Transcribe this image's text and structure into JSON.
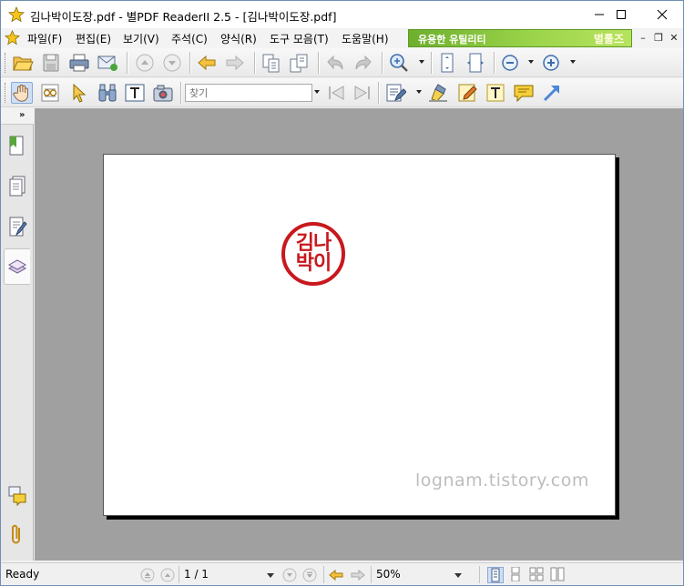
{
  "window": {
    "title": "김나박이도장.pdf - 별PDF ReaderII 2.5 - [김나박이도장.pdf]",
    "controls": {
      "minimize": "–",
      "maximize": "☐",
      "close": "✕"
    }
  },
  "menubar": {
    "items": [
      {
        "label": "파일(F)"
      },
      {
        "label": "편집(E)"
      },
      {
        "label": "보기(V)"
      },
      {
        "label": "주석(C)"
      },
      {
        "label": "양식(R)"
      },
      {
        "label": "도구 모음(T)"
      },
      {
        "label": "도움말(H)"
      }
    ],
    "utility_banner": "유용한 유틸리티",
    "utility_brand": "별툴즈",
    "mdi": {
      "minimize": "–",
      "restore": "❐",
      "close": "✕"
    }
  },
  "toolbar2": {
    "find_placeholder": "찾기"
  },
  "document": {
    "seal_line1": "김나",
    "seal_line2": "박이",
    "watermark": "lognam.tistory.com"
  },
  "statusbar": {
    "status": "Ready",
    "page_display": "1 / 1",
    "zoom": "50%"
  },
  "colors": {
    "seal_red": "#c8181e",
    "doc_background": "#a0a0a0",
    "utility_green": "#7dbe38"
  }
}
